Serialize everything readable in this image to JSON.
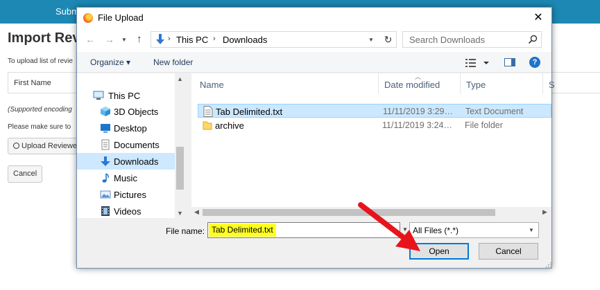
{
  "page": {
    "top_link": "Subm",
    "heading": "Import Revi",
    "instruction": "To upload list of revie",
    "table_header": "First Name",
    "encoding_note": "(Supported encoding",
    "note": "Please make sure to",
    "upload_button": "Upload Reviewe",
    "cancel_button": "Cancel",
    "colors": {
      "topbar": "#1d88b4"
    }
  },
  "dialog": {
    "title": "File Upload",
    "close_glyph": "✕",
    "breadcrumb": [
      "This PC",
      "Downloads"
    ],
    "breadcrumb_sep": "›",
    "search_placeholder": "Search Downloads",
    "organize_label": "Organize ▾",
    "new_folder_label": "New folder",
    "help_glyph": "?",
    "nav_items": [
      {
        "label": "This PC",
        "icon": "computer-icon"
      },
      {
        "label": "3D Objects",
        "icon": "cube-icon"
      },
      {
        "label": "Desktop",
        "icon": "desktop-icon"
      },
      {
        "label": "Documents",
        "icon": "documents-icon"
      },
      {
        "label": "Downloads",
        "icon": "download-icon",
        "selected": true
      },
      {
        "label": "Music",
        "icon": "music-icon"
      },
      {
        "label": "Pictures",
        "icon": "pictures-icon"
      },
      {
        "label": "Videos",
        "icon": "videos-icon"
      }
    ],
    "columns": [
      "Name",
      "Date modified",
      "Type",
      "S"
    ],
    "files": [
      {
        "name": "Tab Delimited.txt",
        "date": "11/11/2019 3:29…",
        "type": "Text Document",
        "icon": "text-file-icon",
        "selected": true
      },
      {
        "name": "archive",
        "date": "11/11/2019 3:24…",
        "type": "File folder",
        "icon": "folder-icon"
      }
    ],
    "file_name_label": "File name:",
    "file_name_value": "Tab Delimited.txt",
    "filter_value": "All Files (*.*)",
    "open_label": "Open",
    "cancel_label": "Cancel",
    "colors": {
      "selection": "#cce8ff",
      "highlight": "#ffff22",
      "focus": "#0078d7",
      "annotation_arrow": "#e8141c"
    }
  }
}
